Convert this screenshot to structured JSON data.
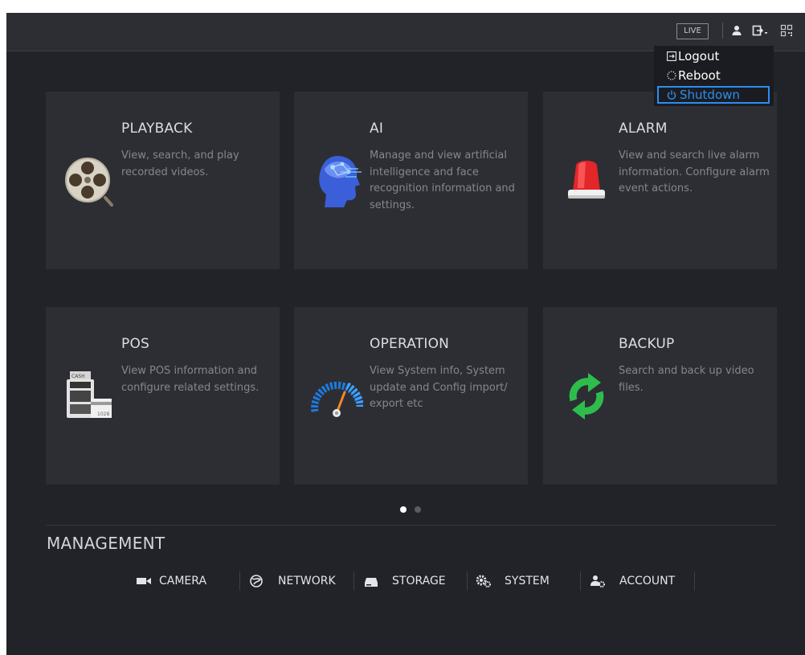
{
  "topbar": {
    "live_label": "LIVE",
    "icons": [
      "user-icon",
      "logout-icon",
      "qr-code-icon"
    ]
  },
  "user_menu": {
    "items": [
      {
        "label": "Logout",
        "icon": "logout-icon"
      },
      {
        "label": "Reboot",
        "icon": "reboot-icon"
      },
      {
        "label": "Shutdown",
        "icon": "power-icon",
        "active": true
      }
    ]
  },
  "cards": [
    {
      "title": "PLAYBACK",
      "description": "View, search, and play recorded videos.",
      "icon": "film-reel-icon"
    },
    {
      "title": "AI",
      "description": "Manage and view artificial intelligence and face recognition information and settings.",
      "icon": "ai-head-icon"
    },
    {
      "title": "ALARM",
      "description": "View and search live alarm information. Configure alarm event actions.",
      "icon": "alarm-light-icon"
    },
    {
      "title": "POS",
      "description": "View POS information and configure related settings.",
      "icon": "cash-register-icon"
    },
    {
      "title": "OPERATION",
      "description": "View System info, System update and Config import/ export etc",
      "icon": "gauge-icon"
    },
    {
      "title": "BACKUP",
      "description": "Search and back up video files.",
      "icon": "refresh-arrows-icon"
    }
  ],
  "pagination": {
    "pages": 2,
    "current": 1
  },
  "management": {
    "title": "MANAGEMENT",
    "items": [
      {
        "label": "CAMERA",
        "icon": "camera-icon"
      },
      {
        "label": "NETWORK",
        "icon": "globe-icon"
      },
      {
        "label": "STORAGE",
        "icon": "storage-icon"
      },
      {
        "label": "SYSTEM",
        "icon": "gears-icon"
      },
      {
        "label": "ACCOUNT",
        "icon": "account-gear-icon"
      }
    ]
  },
  "colors": {
    "background": "#222329",
    "card": "#2d2e34",
    "accent": "#2a8ef2",
    "title_text": "#dcdde1",
    "description_text": "#85878e"
  }
}
